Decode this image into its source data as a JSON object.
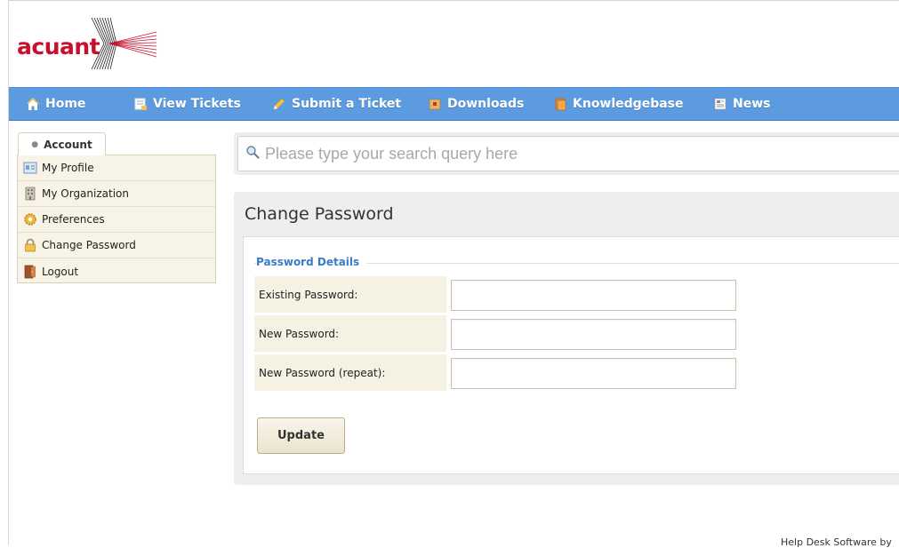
{
  "logo": {
    "text": "acuant"
  },
  "nav": {
    "items": [
      {
        "label": "Home",
        "icon": "home-icon"
      },
      {
        "label": "View Tickets",
        "icon": "tickets-icon"
      },
      {
        "label": "Submit a Ticket",
        "icon": "pencil-icon"
      },
      {
        "label": "Downloads",
        "icon": "package-icon"
      },
      {
        "label": "Knowledgebase",
        "icon": "book-icon"
      },
      {
        "label": "News",
        "icon": "newspaper-icon"
      }
    ]
  },
  "sidebar": {
    "tab_label": "Account",
    "items": [
      {
        "label": "My Profile",
        "icon": "profile-card-icon"
      },
      {
        "label": "My Organization",
        "icon": "building-icon"
      },
      {
        "label": "Preferences",
        "icon": "gear-icon"
      },
      {
        "label": "Change Password",
        "icon": "lock-icon"
      },
      {
        "label": "Logout",
        "icon": "door-icon"
      }
    ]
  },
  "search": {
    "placeholder": "Please type your search query here",
    "value": ""
  },
  "main": {
    "title": "Change Password",
    "fieldset_legend": "Password Details",
    "fields": [
      {
        "label": "Existing Password:",
        "value": ""
      },
      {
        "label": "New Password:",
        "value": ""
      },
      {
        "label": "New Password (repeat):",
        "value": ""
      }
    ],
    "submit_label": "Update"
  },
  "footer": {
    "text": "Help Desk Software by"
  },
  "colors": {
    "navbar": "#5c9be0",
    "brand_red": "#c8102e",
    "legend_blue": "#3a7bc8"
  }
}
